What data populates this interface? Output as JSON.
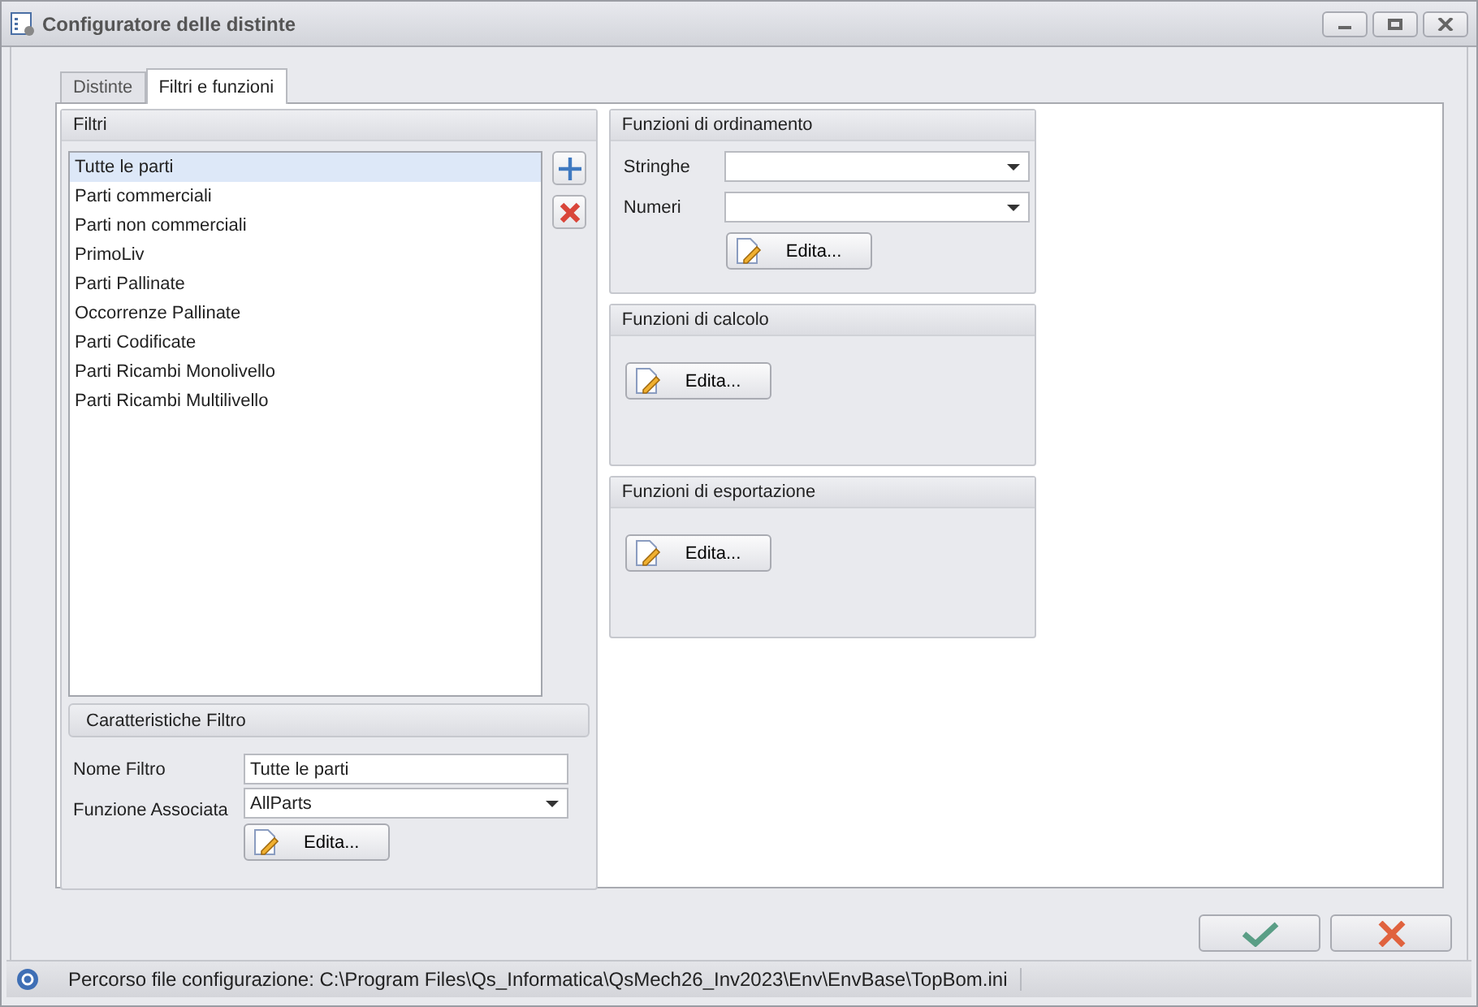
{
  "window": {
    "title": "Configuratore delle distinte"
  },
  "tabs": [
    {
      "label": "Distinte",
      "selected": false
    },
    {
      "label": "Filtri e funzioni",
      "selected": true
    }
  ],
  "filters": {
    "title": "Filtri",
    "items": [
      {
        "label": "Tutte le parti",
        "selected": true
      },
      {
        "label": "Parti commerciali",
        "selected": false
      },
      {
        "label": "Parti non commerciali",
        "selected": false
      },
      {
        "label": "PrimoLiv",
        "selected": false
      },
      {
        "label": "Parti Pallinate",
        "selected": false
      },
      {
        "label": "Occorrenze Pallinate",
        "selected": false
      },
      {
        "label": "Parti Codificate",
        "selected": false
      },
      {
        "label": "Parti Ricambi Monolivello",
        "selected": false
      },
      {
        "label": "Parti Ricambi Multilivello",
        "selected": false
      }
    ]
  },
  "filter_properties": {
    "title": "Caratteristiche Filtro",
    "name_label": "Nome Filtro",
    "name_value": "Tutte le parti",
    "function_label": "Funzione Associata",
    "function_value": "AllParts",
    "edit_button": "Edita..."
  },
  "sorting": {
    "title": "Funzioni di ordinamento",
    "fields": [
      {
        "label": "Stringhe"
      },
      {
        "label": "Numeri"
      }
    ],
    "edit_button": "Edita..."
  },
  "calculation": {
    "title": "Funzioni di calcolo",
    "edit_button": "Edita..."
  },
  "export": {
    "title": "Funzioni di esportazione",
    "edit_button": "Edita..."
  },
  "status_bar": {
    "text": "Percorso file configurazione: C:\\Program Files\\Qs_Informatica\\QsMech26_Inv2023\\Env\\EnvBase\\TopBom.ini"
  }
}
